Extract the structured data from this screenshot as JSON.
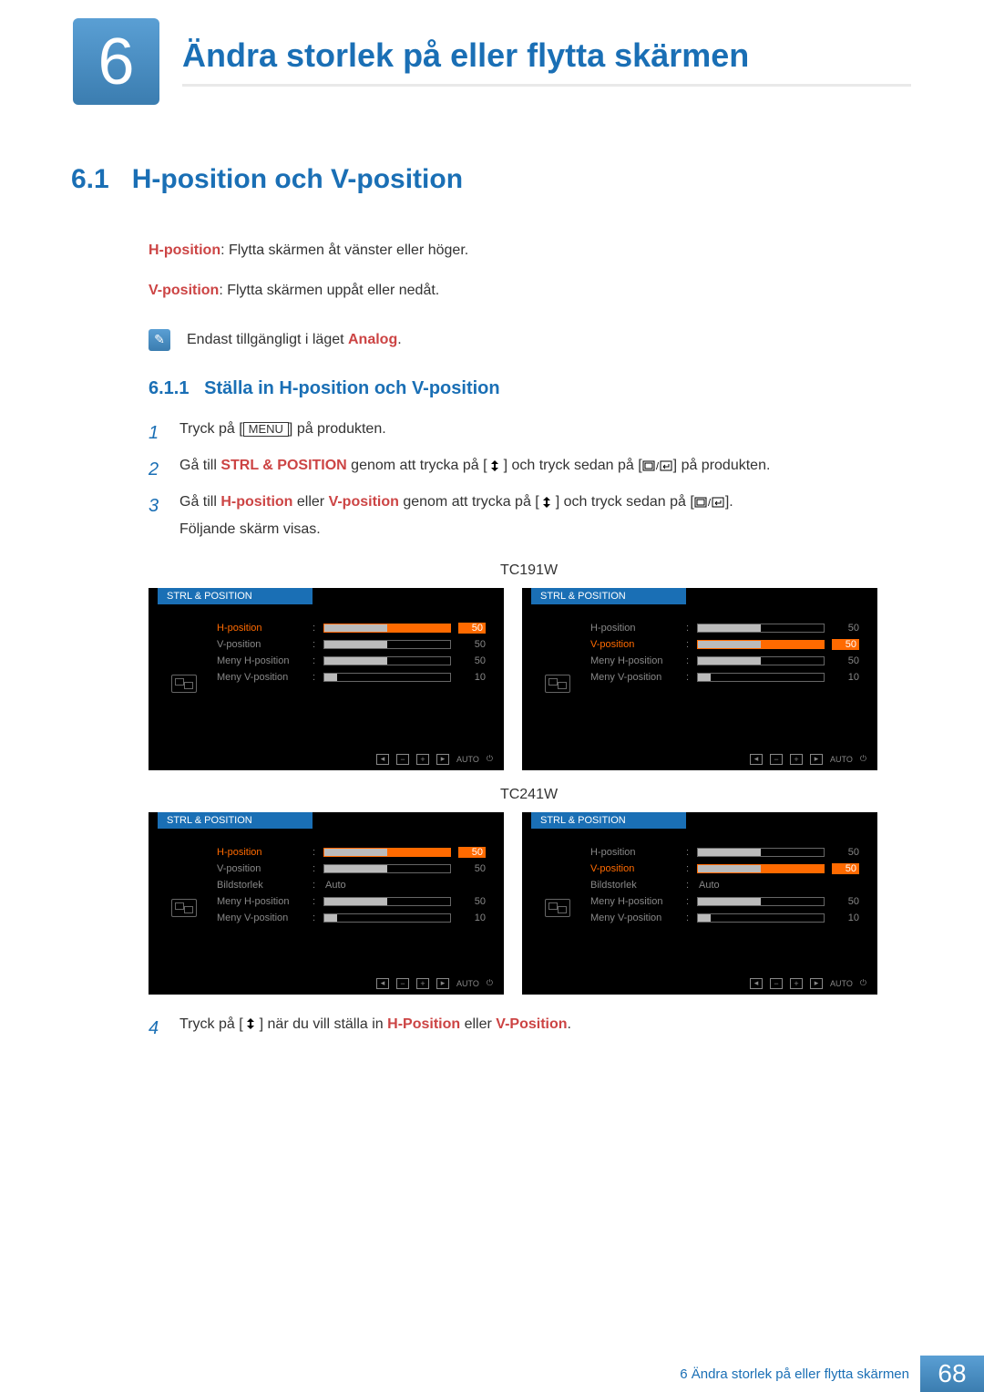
{
  "chapter": {
    "number": "6",
    "title": "Ändra storlek på eller flytta skärmen"
  },
  "section": {
    "number": "6.1",
    "title": "H-position och V-position"
  },
  "definitions": {
    "hposition_term": "H-position",
    "hposition_text": ": Flytta skärmen åt vänster eller höger.",
    "vposition_term": "V-position",
    "vposition_text": ": Flytta skärmen uppåt eller nedåt."
  },
  "note": {
    "prefix": "Endast tillgängligt i läget ",
    "mode": "Analog",
    "suffix": "."
  },
  "subsection": {
    "number": "6.1.1",
    "title": "Ställa in H-position och V-position"
  },
  "steps": {
    "s1_pre": "Tryck på [",
    "s1_menu": "MENU",
    "s1_post": "] på produkten.",
    "s2_pre": "Gå till ",
    "s2_target": "STRL & POSITION",
    "s2_mid1": " genom att trycka på [",
    "s2_mid2": "] och tryck sedan på [",
    "s2_post": "] på produkten.",
    "s3_pre": "Gå till ",
    "s3_h": "H-position",
    "s3_or": " eller ",
    "s3_v": "V-position",
    "s3_mid1": " genom att trycka på [",
    "s3_mid2": "] och tryck sedan på [",
    "s3_post": "].",
    "s3_line2": "Följande skärm visas.",
    "s4_pre": "Tryck på [",
    "s4_mid": "] när du vill ställa in ",
    "s4_h": "H-Position",
    "s4_or": " eller ",
    "s4_v": "V-Position",
    "s4_post": "."
  },
  "osd": {
    "header": "STRL & POSITION",
    "model1_label": "TC191W",
    "model2_label": "TC241W",
    "items_basic": [
      {
        "label": "H-position",
        "value": "50",
        "fill": 50
      },
      {
        "label": "V-position",
        "value": "50",
        "fill": 50
      },
      {
        "label": "Meny H-position",
        "value": "50",
        "fill": 50
      },
      {
        "label": "Meny V-position",
        "value": "10",
        "fill": 10
      }
    ],
    "items_ext": [
      {
        "label": "H-position",
        "value": "50",
        "fill": 50
      },
      {
        "label": "V-position",
        "value": "50",
        "fill": 50
      },
      {
        "label": "Bildstorlek",
        "value": "Auto",
        "fill": null
      },
      {
        "label": "Meny H-position",
        "value": "50",
        "fill": 50
      },
      {
        "label": "Meny V-position",
        "value": "10",
        "fill": 10
      }
    ],
    "auto_label": "AUTO"
  },
  "footer": {
    "text": "6 Ändra storlek på eller flytta skärmen",
    "page": "68"
  }
}
